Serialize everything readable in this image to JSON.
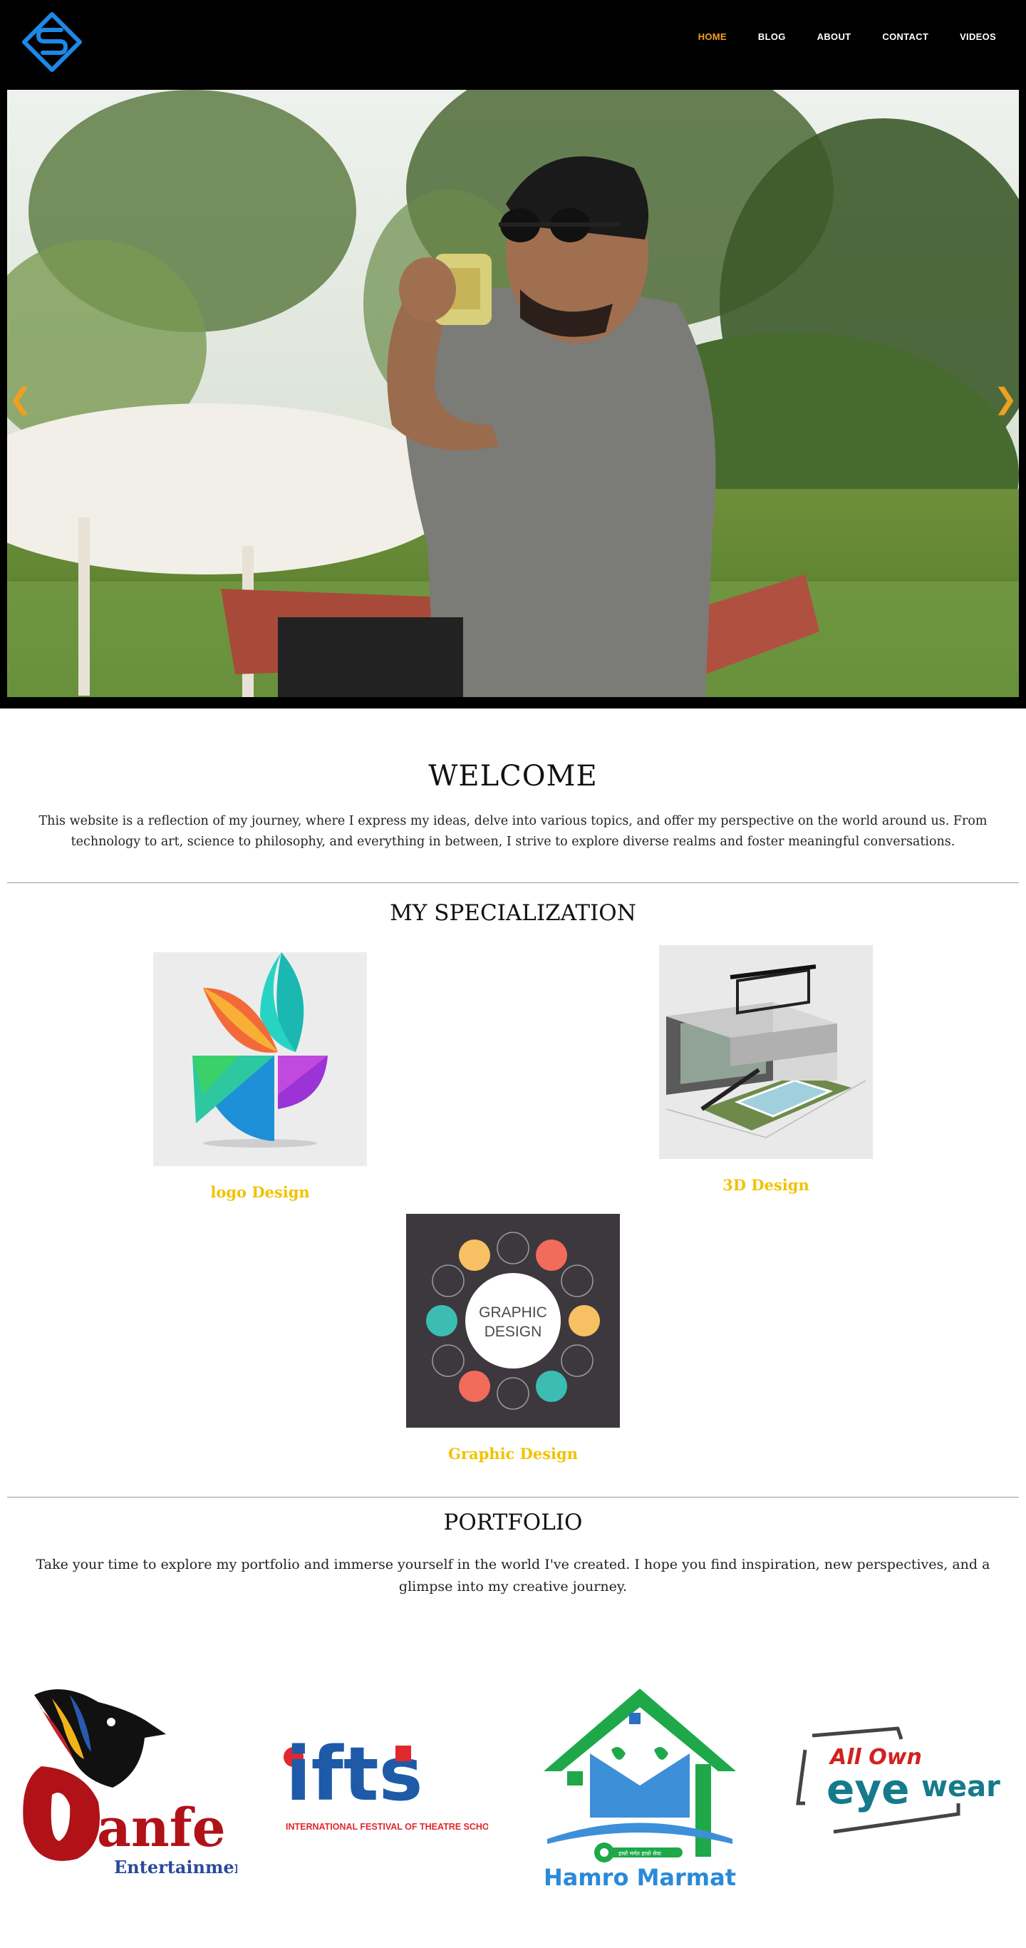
{
  "header": {
    "logo_icon": "s-diamond-logo-icon",
    "nav": [
      {
        "label": "HOME",
        "active": true
      },
      {
        "label": "BLOG",
        "active": false
      },
      {
        "label": "ABOUT",
        "active": false
      },
      {
        "label": "CONTACT",
        "active": false
      },
      {
        "label": "VIDEOS",
        "active": false
      }
    ]
  },
  "hero": {
    "prev_arrow": "❮",
    "next_arrow": "❯"
  },
  "welcome": {
    "title": "WELCOME",
    "text": "This website is a reflection of my journey, where I express my ideas, delve into various topics, and offer my perspective on the world around us. From technology to art, science to philosophy, and everything in between, I strive to explore diverse realms and foster meaningful conversations."
  },
  "specialization": {
    "title": "MY SPECIALIZATION",
    "items": [
      {
        "caption": "logo Design"
      },
      {
        "caption": "3D Design"
      },
      {
        "caption": "Graphic Design",
        "image_text_1": "GRAPHIC",
        "image_text_2": "DESIGN"
      }
    ]
  },
  "portfolio": {
    "title": "PORTFOLIO",
    "text": "Take your time to explore my portfolio and immerse yourself in the world I've created. I hope you find inspiration, new perspectives, and a glimpse into my creative journey.",
    "logos": [
      {
        "line1": "anfe",
        "line2": "Entertainment"
      },
      {
        "line1": "ifts",
        "line2": "INTERNATIONAL FESTIVAL OF THEATRE SCHOOLS"
      },
      {
        "line1": "Hamro Marmat",
        "line2": "हाम्रो मर्मत हाम्रो सेवा"
      },
      {
        "line1": "All Own",
        "line2": "eye",
        "line3": "wear"
      }
    ]
  },
  "colors": {
    "accent": "#f0a020",
    "caption": "#f2c200",
    "header_bg": "#000000"
  }
}
